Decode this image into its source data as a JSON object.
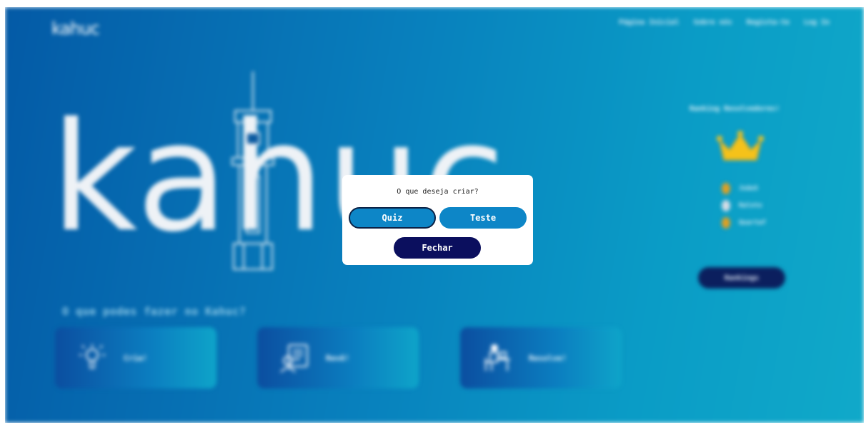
{
  "header": {
    "logo": "kahuc",
    "nav": [
      "Página Inicial",
      "Sobre nós",
      "Regista-te",
      "Log In"
    ]
  },
  "hero": {
    "word": "kahuc"
  },
  "features": {
    "title": "O que podes fazer no Kahuc?",
    "cards": [
      {
        "label": "Cria!",
        "icon": "lightbulb-icon"
      },
      {
        "label": "Revê!",
        "icon": "document-person-icon"
      },
      {
        "label": "Resolve!",
        "icon": "person-at-desk-icon"
      }
    ]
  },
  "ranking": {
    "title": "Ranking Resolvedores!",
    "icon": "crown-icon",
    "entries": [
      {
        "name": "JoãoS",
        "medal_color": "#e0a020"
      },
      {
        "name": "Ralnto",
        "medal_color": "#d8dde6"
      },
      {
        "name": "Quartaf",
        "medal_color": "#e0a020"
      }
    ],
    "button_label": "Rankings"
  },
  "modal": {
    "title": "O que deseja criar?",
    "quiz_label": "Quiz",
    "teste_label": "Teste",
    "close_label": "Fechar"
  },
  "colors": {
    "modal_button": "#0d86c7",
    "close_button": "#0b0f5e",
    "background_start": "#045aa6",
    "background_end": "#10a9c9"
  }
}
